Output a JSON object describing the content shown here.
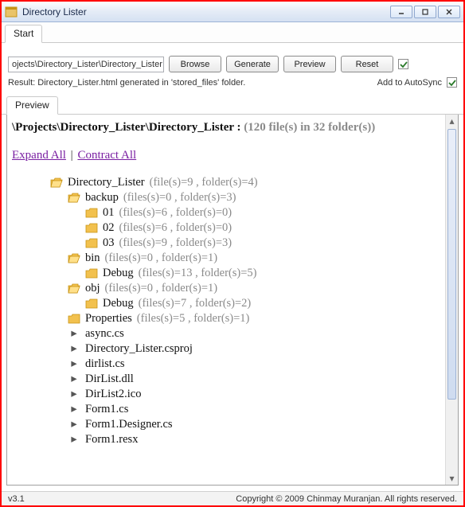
{
  "window": {
    "title": "Directory Lister"
  },
  "tabs": {
    "start": "Start"
  },
  "controls": {
    "path_value": "ojects\\Directory_Lister\\Directory_Lister",
    "browse": "Browse",
    "generate": "Generate",
    "preview": "Preview",
    "reset": "Reset"
  },
  "result": {
    "text": "Result: Directory_Lister.html generated in 'stored_files' folder.",
    "autosync_label": "Add to AutoSync"
  },
  "inner_tabs": {
    "preview": "Preview"
  },
  "preview": {
    "headline_path": "\\Projects\\Directory_Lister\\Directory_Lister : ",
    "headline_stats": "(120 file(s) in 32 folder(s))",
    "expand_all": "Expand All",
    "contract_all": "Contract All"
  },
  "tree": [
    {
      "level": 1,
      "type": "folder_open",
      "name": "Directory_Lister",
      "meta": "(file(s)=9 , folder(s)=4)"
    },
    {
      "level": 2,
      "type": "folder_open",
      "name": "backup",
      "meta": "(files(s)=0 , folder(s)=3)"
    },
    {
      "level": 3,
      "type": "folder_closed",
      "name": "01",
      "meta": "(files(s)=6 , folder(s)=0)"
    },
    {
      "level": 3,
      "type": "folder_closed",
      "name": "02",
      "meta": "(files(s)=6 , folder(s)=0)"
    },
    {
      "level": 3,
      "type": "folder_closed",
      "name": "03",
      "meta": "(files(s)=9 , folder(s)=3)"
    },
    {
      "level": 2,
      "type": "folder_open",
      "name": "bin",
      "meta": "(files(s)=0 , folder(s)=1)"
    },
    {
      "level": 3,
      "type": "folder_closed",
      "name": "Debug",
      "meta": "(files(s)=13 , folder(s)=5)"
    },
    {
      "level": 2,
      "type": "folder_open",
      "name": "obj",
      "meta": "(files(s)=0 , folder(s)=1)"
    },
    {
      "level": 3,
      "type": "folder_closed",
      "name": "Debug",
      "meta": "(files(s)=7 , folder(s)=2)"
    },
    {
      "level": 2,
      "type": "folder_closed",
      "name": "Properties",
      "meta": "(files(s)=5 , folder(s)=1)"
    },
    {
      "level": 2,
      "type": "file",
      "name": "async.cs"
    },
    {
      "level": 2,
      "type": "file",
      "name": "Directory_Lister.csproj"
    },
    {
      "level": 2,
      "type": "file",
      "name": "dirlist.cs"
    },
    {
      "level": 2,
      "type": "file",
      "name": "DirList.dll"
    },
    {
      "level": 2,
      "type": "file",
      "name": "DirList2.ico"
    },
    {
      "level": 2,
      "type": "file",
      "name": "Form1.cs"
    },
    {
      "level": 2,
      "type": "file",
      "name": "Form1.Designer.cs"
    },
    {
      "level": 2,
      "type": "file",
      "name": "Form1.resx"
    }
  ],
  "status": {
    "version": "v3.1",
    "copyright": "Copyright © 2009 Chinmay Muranjan. All rights reserved."
  }
}
